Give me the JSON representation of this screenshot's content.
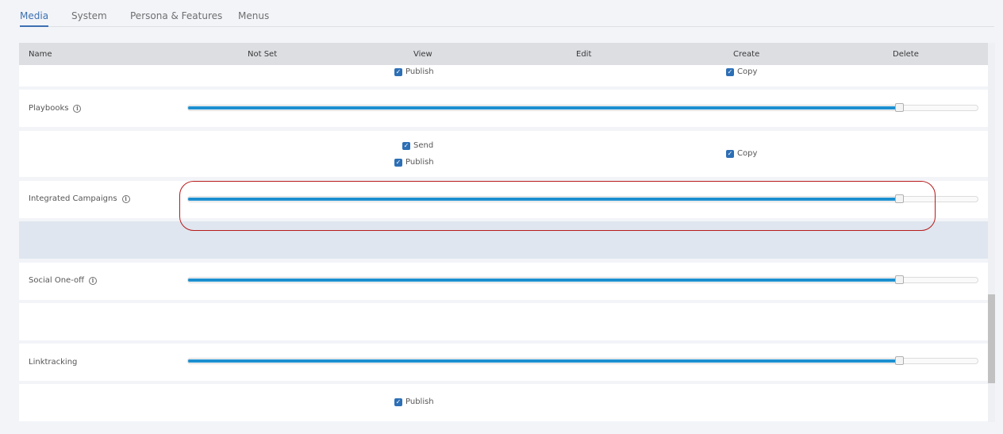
{
  "tabs": [
    {
      "label": "Media",
      "active": true
    },
    {
      "label": "System",
      "active": false
    },
    {
      "label": "Persona & Features",
      "active": false
    },
    {
      "label": "Menus",
      "active": false
    }
  ],
  "table": {
    "headers": [
      "Name",
      "Not Set",
      "View",
      "Edit",
      "Create",
      "Delete"
    ]
  },
  "rows": {
    "top_options": {
      "view_publish": "Publish",
      "create_copy": "Copy"
    },
    "playbooks": {
      "label": "Playbooks",
      "level_fraction": 0.9
    },
    "playbooks_options": {
      "view_send": "Send",
      "view_publish": "Publish",
      "create_copy": "Copy"
    },
    "integrated_campaigns": {
      "label": "Integrated Campaigns",
      "level_fraction": 0.9
    },
    "social_oneoff": {
      "label": "Social One-off",
      "level_fraction": 0.9
    },
    "linktracking": {
      "label": "Linktracking",
      "level_fraction": 0.9
    },
    "linktracking_options": {
      "view_publish": "Publish"
    }
  },
  "icons": {
    "info": "info-icon",
    "check": "check-icon"
  },
  "colors": {
    "accent": "#3d70b2",
    "slider_fill": "#1c8fd0",
    "checkbox": "#2d6fb5",
    "highlight": "#b81a1a",
    "selected_row": "#dfe6ef"
  }
}
